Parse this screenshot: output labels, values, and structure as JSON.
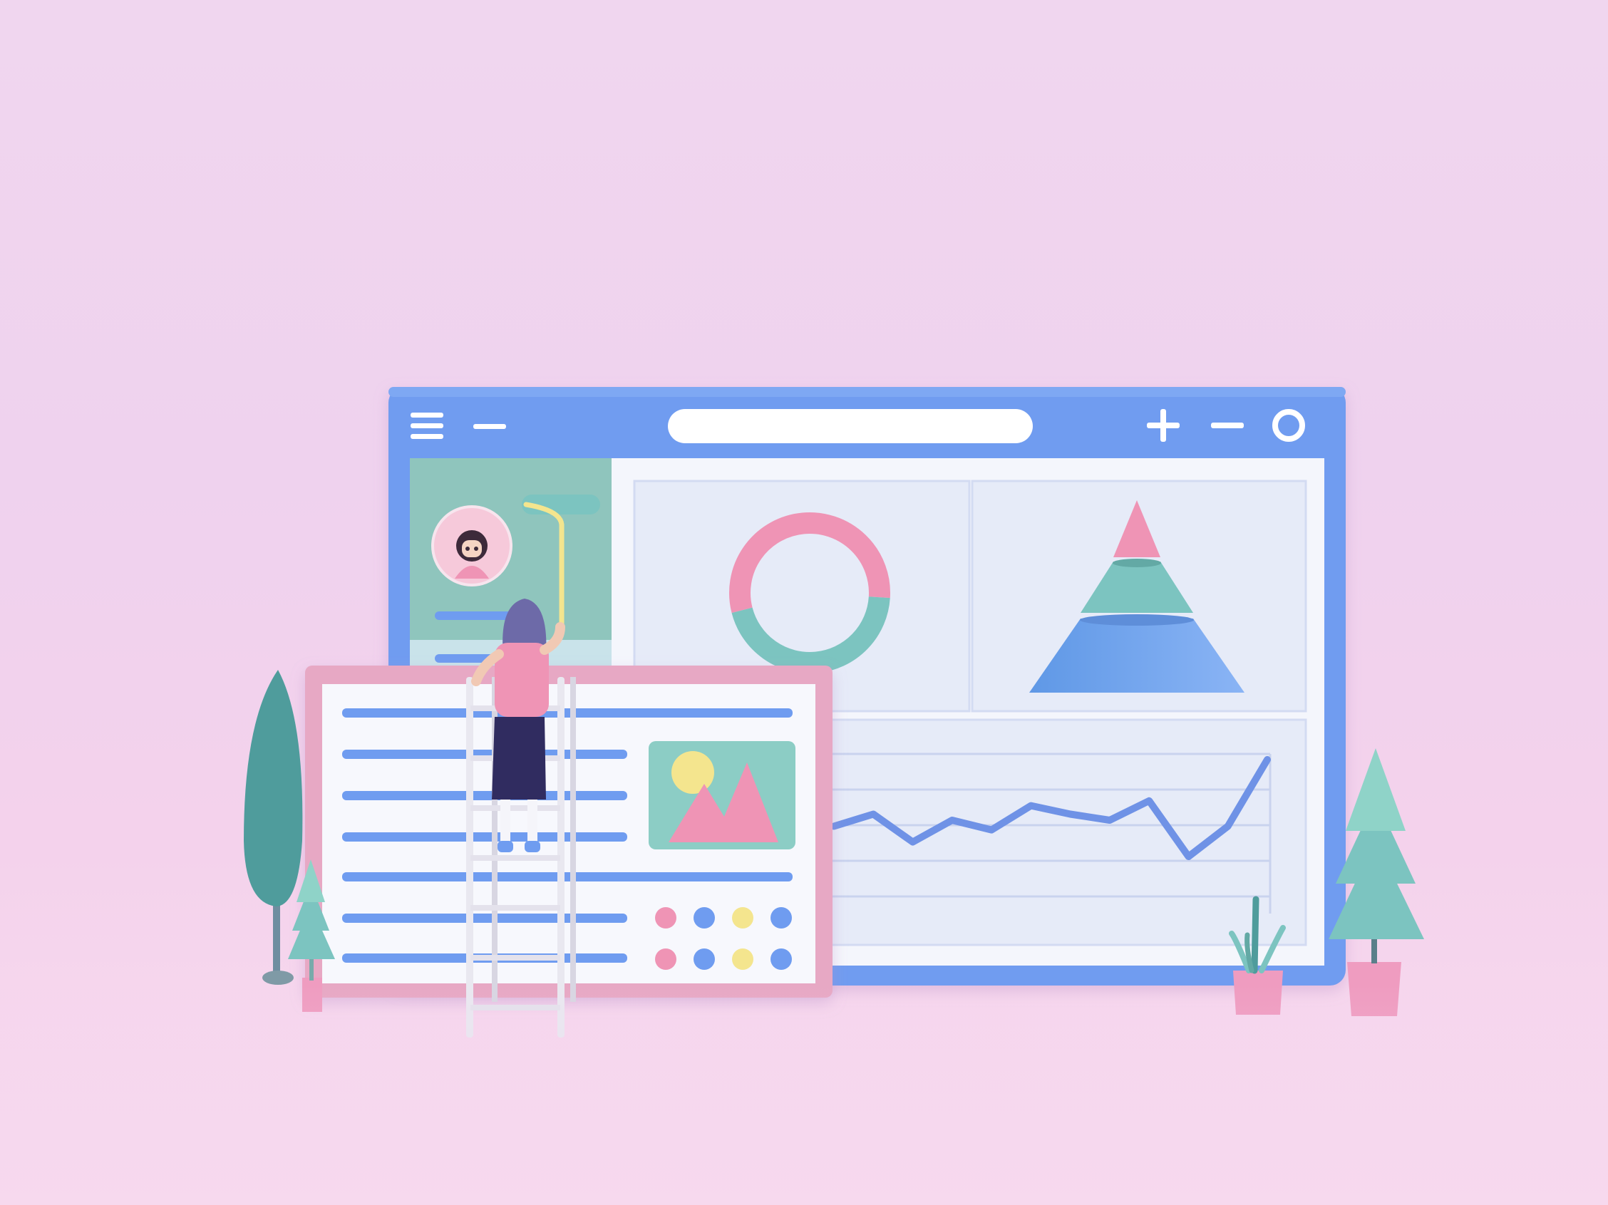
{
  "scene": {
    "description_free": true,
    "colors": {
      "background": "#f0d4ee",
      "browser_frame": "#6f9cf0",
      "browser_content": "#eef2fb",
      "panel": "#e7ecf9",
      "pink": "#ef94b5",
      "teal": "#7cc4c0",
      "blue": "#6f9cf0",
      "yellow": "#f4e58e",
      "dark_teal": "#4f9c9c",
      "front_card_border": "#e7a8c4",
      "front_card_fill": "#f7f8fd",
      "image_card": "#8ccdc5",
      "line_chart": "#6f92e6"
    },
    "icons": [
      "hamburger-menu-icon",
      "minimize-dash-icon",
      "plus-icon",
      "minus-icon",
      "circle-icon",
      "image-placeholder-icon",
      "avatar-icon"
    ],
    "dot_grid": {
      "rows": 2,
      "colors": [
        "#ef94b5",
        "#6f9cf0",
        "#f4e58e",
        "#6f9cf0"
      ]
    },
    "donut_chart": {
      "segments": [
        {
          "color": "#ef94b5",
          "share": 0.55
        },
        {
          "color": "#7cc4c0",
          "share": 0.45
        }
      ]
    },
    "pyramid_chart": {
      "tiers": [
        {
          "color": "#ef94b5"
        },
        {
          "color": "#7cc4c0"
        },
        {
          "color": "#6f9cf0"
        }
      ]
    },
    "line_chart": {
      "values": [
        0.45,
        0.55,
        0.32,
        0.5,
        0.42,
        0.62,
        0.55,
        0.5,
        0.66,
        0.2,
        0.45,
        1.0
      ]
    }
  }
}
